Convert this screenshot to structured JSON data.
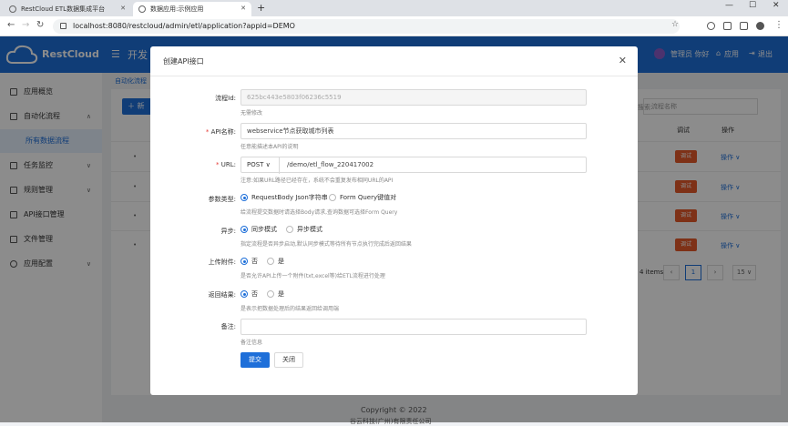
{
  "browser": {
    "tabs": [
      {
        "title": "RestCloud ETL数据集成平台"
      },
      {
        "title": "数据应用:示例应用"
      }
    ],
    "new_tab": "+",
    "url": "localhost:8080/restcloud/admin/etl/application?appid=DEMO"
  },
  "header": {
    "logo_text": "RestCloud",
    "app_title": "开发",
    "user": "管理员 你好",
    "home": "应用",
    "logout": "退出"
  },
  "sidebar": {
    "items": [
      {
        "label": "应用概览"
      },
      {
        "label": "自动化流程"
      },
      {
        "label": "所有数据流程"
      },
      {
        "label": "任务监控"
      },
      {
        "label": "规则管理"
      },
      {
        "label": "API接口管理"
      },
      {
        "label": "文件管理"
      },
      {
        "label": "应用配置"
      }
    ]
  },
  "main": {
    "breadcrumb": "自动化流程",
    "new_button": "新",
    "search_label": "搜索:",
    "search_placeholder": "流程名称",
    "columns": {
      "debug": "调试",
      "op": "操作"
    },
    "rows": [
      {
        "debug": "调试",
        "op": "操作 ∨"
      },
      {
        "debug": "调试",
        "op": "操作 ∨"
      },
      {
        "debug": "调试",
        "op": "操作 ∨"
      },
      {
        "debug": "调试",
        "op": "操作 ∨"
      }
    ],
    "pager": {
      "total": "4 items",
      "page": "1",
      "size": "15"
    },
    "footer": {
      "copyright": "Copyright © 2022",
      "company": "谷云科技(广州)有限责任公司"
    }
  },
  "modal": {
    "title": "创建API接口",
    "fields": {
      "flow_id": {
        "label": "流程Id:",
        "value": "625bc443e5803f06236c5519",
        "hint": "无需修改"
      },
      "api_name": {
        "label": "API名称:",
        "value": "webservice节点获取城市列表",
        "hint": "任意能描述本API的说明"
      },
      "url": {
        "label": "URL:",
        "method": "POST",
        "value": "/demo/etl_flow_220417002",
        "hint": "注意:如果URL路径已经存在，系统不会重复发布相同URL的API"
      },
      "param_type": {
        "label": "参数类型:",
        "opt1": "RequestBody Json字符串",
        "opt2": "Form Query键值对",
        "hint": "给流程提交数据时请选择Body请求,查询数据可选择Form Query"
      },
      "async": {
        "label": "异步:",
        "opt1": "同步模式",
        "opt2": "异步模式",
        "hint": "指定流程是否异步启动,默认同步模式等待所有节点执行完成后返回结果"
      },
      "upload": {
        "label": "上传附件:",
        "opt1": "否",
        "opt2": "是",
        "hint": "是否允许API上传一个附件(txt,excel等)给ETL流程进行处理"
      },
      "result": {
        "label": "返回结果:",
        "opt1": "否",
        "opt2": "是",
        "hint": "是表示把数据处理后的结果返回给调用端"
      },
      "remark": {
        "label": "备注:",
        "value": "",
        "hint": "备注信息"
      }
    },
    "submit": "提交",
    "close": "关闭"
  }
}
